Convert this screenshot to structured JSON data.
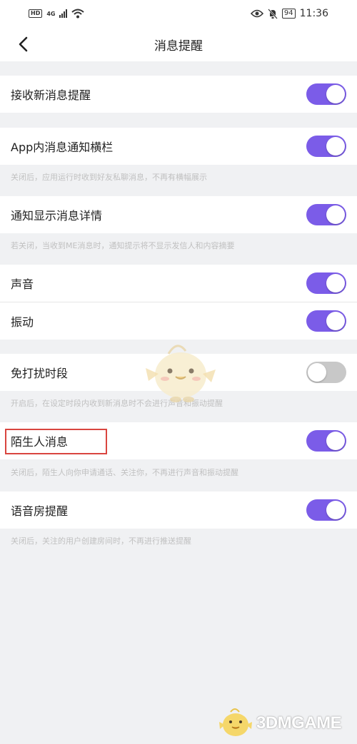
{
  "status_bar": {
    "hd": "HD",
    "network": "4G",
    "battery": "94",
    "time": "11:36"
  },
  "navbar": {
    "title": "消息提醒"
  },
  "settings": {
    "receive_new": {
      "label": "接收新消息提醒",
      "enabled": true
    },
    "in_app_banner": {
      "label": "App内消息通知横栏",
      "enabled": true,
      "hint": "关闭后，应用运行时收到好友私聊消息，不再有横幅展示"
    },
    "show_details": {
      "label": "通知显示消息详情",
      "enabled": true,
      "hint": "若关闭，当收到ME消息时，通知提示将不显示发信人和内容摘要"
    },
    "sound": {
      "label": "声音",
      "enabled": true
    },
    "vibrate": {
      "label": "振动",
      "enabled": true
    },
    "dnd": {
      "label": "免打扰时段",
      "enabled": false,
      "hint": "开启后，在设定时段内收到新消息时不会进行声音和振动提醒"
    },
    "stranger": {
      "label": "陌生人消息",
      "enabled": true,
      "hint": "关闭后，陌生人向你申请通话、关注你，不再进行声音和振动提醒"
    },
    "voice_room": {
      "label": "语音房提醒",
      "enabled": true,
      "hint": "关闭后，关注的用户创建房间时，不再进行推送提醒"
    }
  },
  "watermark": {
    "text": "3DMGAME"
  },
  "colors": {
    "toggle_on": "#7b5ce8",
    "toggle_off": "#c8c8c8",
    "highlight": "#d9453f"
  }
}
